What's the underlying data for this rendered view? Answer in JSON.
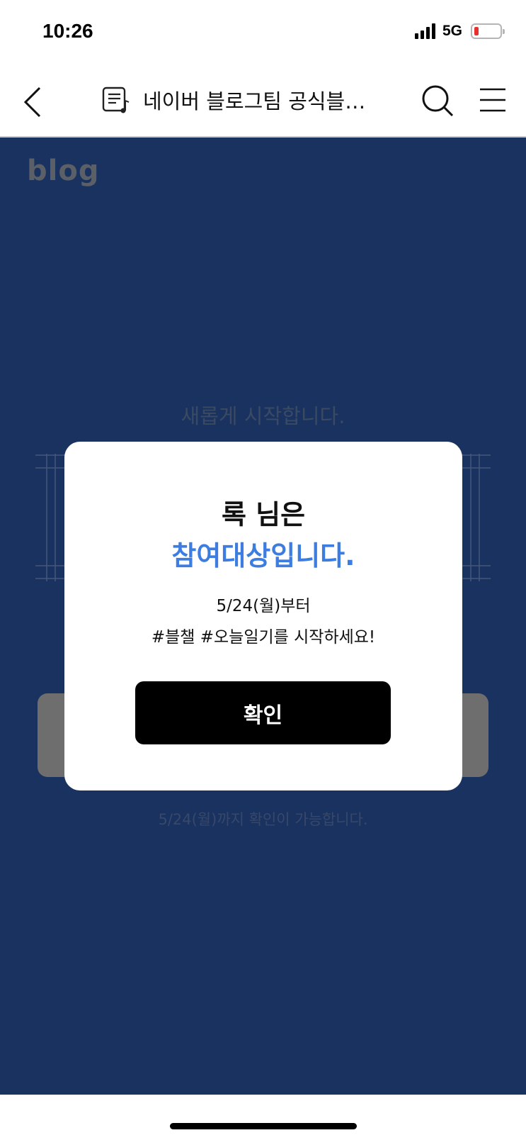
{
  "status_bar": {
    "time": "10:26",
    "network": "5G",
    "battery_color": "#e8312e"
  },
  "nav": {
    "title": "네이버 블로그팀 공식블…",
    "back_icon": "chevron-left-icon",
    "doc_icon": "blog-doc-icon",
    "search_icon": "search-icon",
    "menu_icon": "hamburger-menu-icon"
  },
  "content": {
    "logo": "blog",
    "heading": "새롭게 시작합니다.",
    "deadline_note": "5/24(월)까지 확인이 가능합니다.",
    "background_color": "#193260"
  },
  "modal": {
    "title_line1": "록 님은",
    "title_line2": "참여대상입니다.",
    "desc_line1": "5/24(월)부터",
    "desc_line2": "#블챌 #오늘일기를 시작하세요!",
    "confirm_label": "확인",
    "accent_color": "#3d7de0"
  }
}
